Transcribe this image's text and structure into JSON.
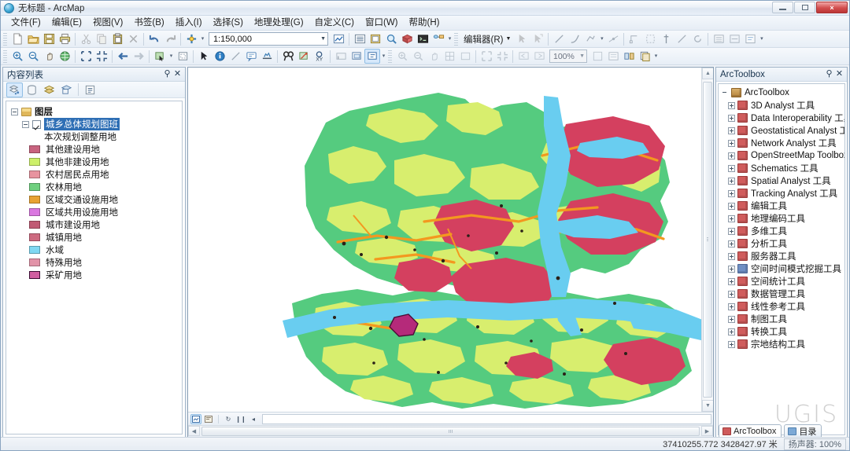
{
  "window": {
    "title": "无标题 - ArcMap",
    "app_icon": "globe-icon",
    "minimize_label": "最小化",
    "maximize_label": "最大化",
    "close_label": "×"
  },
  "menu": {
    "items": [
      {
        "label": "文件(F)",
        "name": "menu-file"
      },
      {
        "label": "编辑(E)",
        "name": "menu-edit"
      },
      {
        "label": "视图(V)",
        "name": "menu-view"
      },
      {
        "label": "书签(B)",
        "name": "menu-bookmarks"
      },
      {
        "label": "插入(I)",
        "name": "menu-insert"
      },
      {
        "label": "选择(S)",
        "name": "menu-selection"
      },
      {
        "label": "地理处理(G)",
        "name": "menu-geoprocessing"
      },
      {
        "label": "自定义(C)",
        "name": "menu-customize"
      },
      {
        "label": "窗口(W)",
        "name": "menu-window"
      },
      {
        "label": "帮助(H)",
        "name": "menu-help"
      }
    ]
  },
  "standard_toolbar": {
    "scale": {
      "value": "1:150,000",
      "arrow": "▼"
    },
    "editor_label": "编辑器(R)",
    "editor_arrow": "▼",
    "buttons": [
      "new-map-icon",
      "open-icon",
      "save-icon",
      "print-icon",
      "cut-icon",
      "copy-icon",
      "paste-icon",
      "delete-icon",
      "undo-icon",
      "redo-icon",
      "add-data-icon",
      "scale-select-icon",
      "editor-toolbar-icon",
      "table-of-contents-icon",
      "catalog-icon",
      "search-icon",
      "arctoolbox-icon",
      "python-window-icon",
      "model-builder-icon"
    ]
  },
  "tools_toolbar": {
    "zoom": {
      "value": "100%",
      "arrow": "▼"
    },
    "buttons": [
      "zoom-in-icon",
      "zoom-out-icon",
      "pan-icon",
      "full-extent-icon",
      "fixed-zoom-in-icon",
      "fixed-zoom-out-icon",
      "go-back-extent-icon",
      "go-next-extent-icon",
      "select-features-icon",
      "clear-selection-icon",
      "select-elements-icon",
      "identify-icon",
      "measure-icon",
      "html-popup-icon",
      "hyperlink-icon",
      "find-icon",
      "find-route-icon",
      "go-to-xy-icon",
      "time-slider-icon",
      "create-viewer-window-icon"
    ]
  },
  "toc": {
    "title": "内容列表",
    "pin_icon": "pin-icon",
    "close_icon": "close-icon",
    "toolbar_buttons": [
      "list-by-drawing-order-icon",
      "list-by-source-icon",
      "list-by-visibility-icon",
      "list-by-selection-icon",
      "options-icon"
    ],
    "root": {
      "label": "图层",
      "icon": "layers-icon"
    },
    "layer": {
      "label": "城乡总体规划图班",
      "selected": true,
      "checked": true
    },
    "sublabel": "本次规划调整用地",
    "legend": [
      {
        "label": "其他建设用地",
        "color": "#c8637f"
      },
      {
        "label": "其他非建设用地",
        "color": "#cdf06a"
      },
      {
        "label": "农村居民点用地",
        "color": "#e8939f"
      },
      {
        "label": "农林用地",
        "color": "#6fd07f"
      },
      {
        "label": "区域交通设施用地",
        "color": "#e8a233"
      },
      {
        "label": "区域共用设施用地",
        "color": "#da77e0"
      },
      {
        "label": "城市建设用地",
        "color": "#c05a74"
      },
      {
        "label": "城镇用地",
        "color": "#cd6a80"
      },
      {
        "label": "水域",
        "color": "#7fd8f2"
      },
      {
        "label": "特殊用地",
        "color": "#e293a8"
      },
      {
        "label": "采矿用地",
        "color": "#d05fa0",
        "outlined": true
      }
    ]
  },
  "arctoolbox": {
    "title": "ArcToolbox",
    "pin_icon": "pin-icon",
    "close_icon": "close-icon",
    "root": "ArcToolbox",
    "items": [
      {
        "label": "3D Analyst 工具",
        "color": "red"
      },
      {
        "label": "Data Interoperability 工具",
        "color": "red"
      },
      {
        "label": "Geostatistical Analyst 工具",
        "color": "red"
      },
      {
        "label": "Network Analyst 工具",
        "color": "red"
      },
      {
        "label": "OpenStreetMap Toolbox",
        "color": "red"
      },
      {
        "label": "Schematics 工具",
        "color": "red"
      },
      {
        "label": "Spatial Analyst 工具",
        "color": "red"
      },
      {
        "label": "Tracking Analyst 工具",
        "color": "red"
      },
      {
        "label": "编辑工具",
        "color": "red"
      },
      {
        "label": "地理编码工具",
        "color": "red"
      },
      {
        "label": "多维工具",
        "color": "red"
      },
      {
        "label": "分析工具",
        "color": "red"
      },
      {
        "label": "服务器工具",
        "color": "red"
      },
      {
        "label": "空间时间模式挖掘工具",
        "color": "blue"
      },
      {
        "label": "空间统计工具",
        "color": "red"
      },
      {
        "label": "数据管理工具",
        "color": "red"
      },
      {
        "label": "线性参考工具",
        "color": "red"
      },
      {
        "label": "制图工具",
        "color": "red"
      },
      {
        "label": "转换工具",
        "color": "red"
      },
      {
        "label": "宗地结构工具",
        "color": "red"
      }
    ],
    "watermark": "UGIS"
  },
  "bottom_tabs": [
    {
      "label": "ArcToolbox",
      "icon": "arctoolbox-icon",
      "active": true
    },
    {
      "label": "目录",
      "icon": "catalog-icon",
      "active": false
    }
  ],
  "status": {
    "coordinates": "37410255.772  3428427.97 米",
    "speaker": "扬声器: 100%"
  },
  "map_colors": {
    "farmland_forest": "#55cb7f",
    "non_construction": "#d8ee6e",
    "urban_construction": "#d4405f",
    "water": "#69cdf0",
    "transport": "#f3981f",
    "mining": "#b52a7a",
    "background": "#ffffff"
  }
}
